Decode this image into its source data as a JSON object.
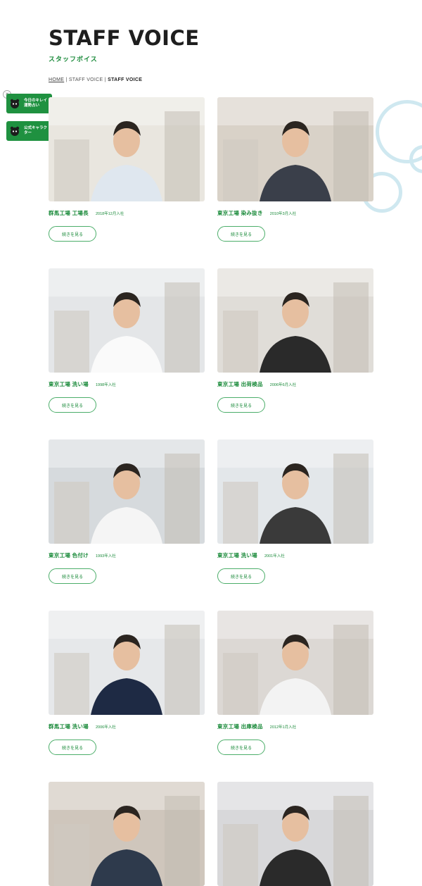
{
  "header": {
    "title": "STAFF VOICE",
    "subtitle": "スタッフボイス"
  },
  "breadcrumb": {
    "home": "HOME",
    "sep1": " | ",
    "parent": "STAFF VOICE",
    "sep2": " | ",
    "current": "STAFF VOICE"
  },
  "side": {
    "close": "×",
    "button1": "今日のキレイ運勢占い",
    "button2": "公式キャラクター"
  },
  "more_label": "続きを見る",
  "cards": [
    {
      "role": "群馬工場 工場長",
      "joined": "2018年12月入社",
      "bg": "#e9e6df",
      "shirt": "#dfe7ef"
    },
    {
      "role": "東京工場 染み抜き",
      "joined": "2010年3月入社",
      "bg": "#d9d2c8",
      "shirt": "#3a3f4a"
    },
    {
      "role": "東京工場 洗い場",
      "joined": "1998年入社",
      "bg": "#e4e6e8",
      "shirt": "#fafafa"
    },
    {
      "role": "東京工場 出荷検品",
      "joined": "2006年6月入社",
      "bg": "#e0ddd8",
      "shirt": "#2a2a2a"
    },
    {
      "role": "東京工場 色付け",
      "joined": "1993年入社",
      "bg": "#d6dadd",
      "shirt": "#f5f5f5"
    },
    {
      "role": "東京工場 洗い場",
      "joined": "2001年入社",
      "bg": "#e3e7ea",
      "shirt": "#3a3a3a"
    },
    {
      "role": "群馬工場 洗い場",
      "joined": "2006年入社",
      "bg": "#e6e8ea",
      "shirt": "#1e2a44"
    },
    {
      "role": "東京工場 出庫検品",
      "joined": "2012年1月入社",
      "bg": "#dcd8d4",
      "shirt": "#f3f3f3"
    },
    {
      "role": "",
      "joined": "",
      "bg": "#cfc6bc",
      "shirt": "#2e3a4c"
    },
    {
      "role": "",
      "joined": "",
      "bg": "#d8d8da",
      "shirt": "#2a2a2a"
    }
  ]
}
